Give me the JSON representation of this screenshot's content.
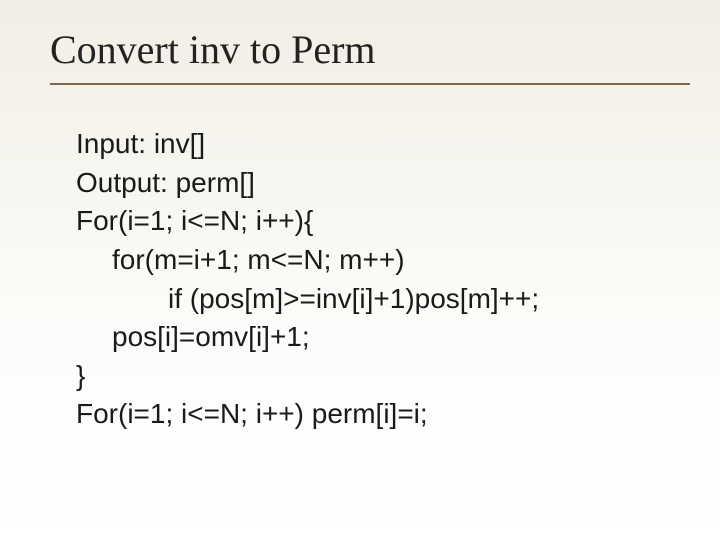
{
  "slide": {
    "title": "Convert inv to Perm",
    "lines": {
      "l0": "Input: inv[]",
      "l1": "Output: perm[]",
      "l2": "For(i=1; i<=N; i++){",
      "l3": "for(m=i+1; m<=N; m++)",
      "l4": "if (pos[m]>=inv[i]+1)pos[m]++;",
      "l5": "pos[i]=omv[i]+1;",
      "l6": "}",
      "l7": "For(i=1; i<=N; i++) perm[i]=i;"
    }
  }
}
